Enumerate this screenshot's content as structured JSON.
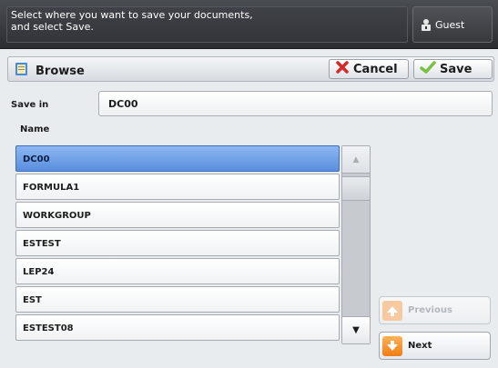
{
  "header": {
    "instruction": "Select where you want to save your documents,\nand select Save.",
    "user_label": "Guest"
  },
  "dialog": {
    "title": "Browse",
    "cancel_label": "Cancel",
    "save_label": "Save",
    "save_in_label": "Save in",
    "save_in_value": "DC00",
    "column_header": "Name"
  },
  "list": {
    "items": [
      "DC00",
      "FORMULA1",
      "WORKGROUP",
      "ESTEST",
      "LEP24",
      "EST",
      "ESTEST08"
    ],
    "selected": "DC00"
  },
  "nav": {
    "previous_label": "Previous",
    "next_label": "Next"
  },
  "colors": {
    "selected_row": "#6b9be6",
    "cancel_icon": "#d8282a",
    "save_icon": "#7ac143",
    "next_icon": "#f59122"
  }
}
